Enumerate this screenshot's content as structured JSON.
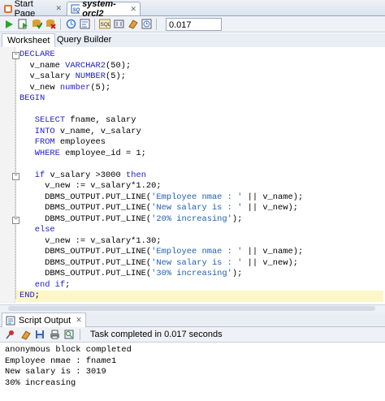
{
  "doc_tabs": [
    {
      "label": "Start Page",
      "icon": "start-page-icon"
    },
    {
      "label": "system-orcl2",
      "icon": "sql-worksheet-icon"
    }
  ],
  "toolbar": {
    "icons": [
      "run-statement-icon",
      "run-script-icon",
      "commit-icon",
      "rollback-icon",
      "autotrace-icon",
      "explain-plan-icon",
      "clear-icon",
      "sql-tuning-icon",
      "unshared-sql-icon",
      "eraser-icon",
      "history-icon"
    ],
    "timing": "0.017 seconds"
  },
  "sub_tabs": [
    "Worksheet",
    "Query Builder"
  ],
  "code_lines": [
    [
      [
        "kw",
        "DECLARE"
      ]
    ],
    [
      [
        "t",
        "  v_name "
      ],
      [
        "kw",
        "VARCHAR2"
      ],
      [
        "t",
        "(50);"
      ]
    ],
    [
      [
        "t",
        "  v_salary "
      ],
      [
        "kw",
        "NUMBER"
      ],
      [
        "t",
        "(5);"
      ]
    ],
    [
      [
        "t",
        "  v_new "
      ],
      [
        "kw",
        "number"
      ],
      [
        "t",
        "(5);"
      ]
    ],
    [
      [
        "kw",
        "BEGIN"
      ]
    ],
    [
      [
        "t",
        ""
      ]
    ],
    [
      [
        "t",
        "   "
      ],
      [
        "kw",
        "SELECT"
      ],
      [
        "t",
        " fname, salary"
      ]
    ],
    [
      [
        "t",
        "   "
      ],
      [
        "kw",
        "INTO"
      ],
      [
        "t",
        " v_name, v_salary"
      ]
    ],
    [
      [
        "t",
        "   "
      ],
      [
        "kw",
        "FROM"
      ],
      [
        "t",
        " employees"
      ]
    ],
    [
      [
        "t",
        "   "
      ],
      [
        "kw",
        "WHERE"
      ],
      [
        "t",
        " employee_id = 1;"
      ]
    ],
    [
      [
        "t",
        ""
      ]
    ],
    [
      [
        "t",
        "   "
      ],
      [
        "kw",
        "if"
      ],
      [
        "t",
        " v_salary >3000 "
      ],
      [
        "kw",
        "then"
      ]
    ],
    [
      [
        "t",
        "     v_new := v_salary*1.20;"
      ]
    ],
    [
      [
        "t",
        "     DBMS_OUTPUT.PUT_LINE("
      ],
      [
        "str",
        "'Employee nmae : '"
      ],
      [
        "t",
        " || v_name);"
      ]
    ],
    [
      [
        "t",
        "     DBMS_OUTPUT.PUT_LINE("
      ],
      [
        "str",
        "'New salary is : '"
      ],
      [
        "t",
        " || v_new);"
      ]
    ],
    [
      [
        "t",
        "     DBMS_OUTPUT.PUT_LINE("
      ],
      [
        "str",
        "'20% increasing'"
      ],
      [
        "t",
        ");"
      ]
    ],
    [
      [
        "t",
        "   "
      ],
      [
        "kw",
        "else"
      ]
    ],
    [
      [
        "t",
        "     v_new := v_salary*1.30;"
      ]
    ],
    [
      [
        "t",
        "     DBMS_OUTPUT.PUT_LINE("
      ],
      [
        "str",
        "'Employee nmae : '"
      ],
      [
        "t",
        " || v_name);"
      ]
    ],
    [
      [
        "t",
        "     DBMS_OUTPUT.PUT_LINE("
      ],
      [
        "str",
        "'New salary is : '"
      ],
      [
        "t",
        " || v_new);"
      ]
    ],
    [
      [
        "t",
        "     DBMS_OUTPUT.PUT_LINE("
      ],
      [
        "str",
        "'30% increasing'"
      ],
      [
        "t",
        ");"
      ]
    ],
    [
      [
        "t",
        "   "
      ],
      [
        "kw",
        "end if"
      ],
      [
        "t",
        ";"
      ]
    ],
    [
      [
        "kw",
        "END"
      ],
      [
        "t",
        ";"
      ]
    ]
  ],
  "output_panel": {
    "tab_label": "Script Output",
    "status": "Task completed in 0.017 seconds",
    "toolbar_icons": [
      "pin-icon",
      "eraser-icon",
      "save-icon",
      "print-icon",
      "find-icon"
    ],
    "lines": [
      "anonymous block completed",
      "Employee nmae : fname1",
      "New salary is : 3019",
      "30% increasing"
    ]
  },
  "colors": {
    "keyword": "#2020c8",
    "string": "#2060b0",
    "current_line": "#fcf6c8"
  }
}
